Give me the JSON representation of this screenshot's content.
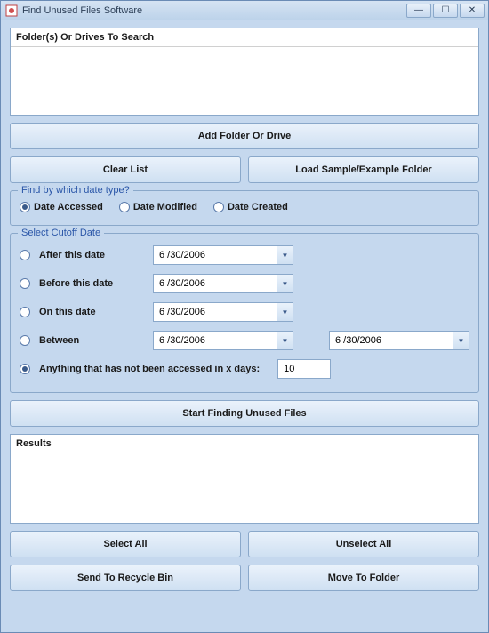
{
  "window": {
    "title": "Find Unused Files Software"
  },
  "folders": {
    "header": "Folder(s) Or Drives To Search"
  },
  "buttons": {
    "addFolder": "Add Folder Or Drive",
    "clearList": "Clear List",
    "loadSample": "Load Sample/Example Folder",
    "startFinding": "Start Finding Unused Files",
    "selectAll": "Select All",
    "unselectAll": "Unselect All",
    "sendRecycle": "Send To Recycle Bin",
    "moveFolder": "Move To Folder"
  },
  "dateType": {
    "legend": "Find by which date type?",
    "accessed": "Date Accessed",
    "modified": "Date Modified",
    "created": "Date Created",
    "selected": "accessed"
  },
  "cutoff": {
    "legend": "Select Cutoff Date",
    "after": "After this date",
    "before": "Before this date",
    "on": "On this date",
    "between": "Between",
    "anything": "Anything that has not been accessed in x days:",
    "date1": "6 /30/2006",
    "date2": "6 /30/2006",
    "date3": "6 /30/2006",
    "date4": "6 /30/2006",
    "date5": "6 /30/2006",
    "days": "10",
    "selected": "anything"
  },
  "results": {
    "header": "Results"
  }
}
